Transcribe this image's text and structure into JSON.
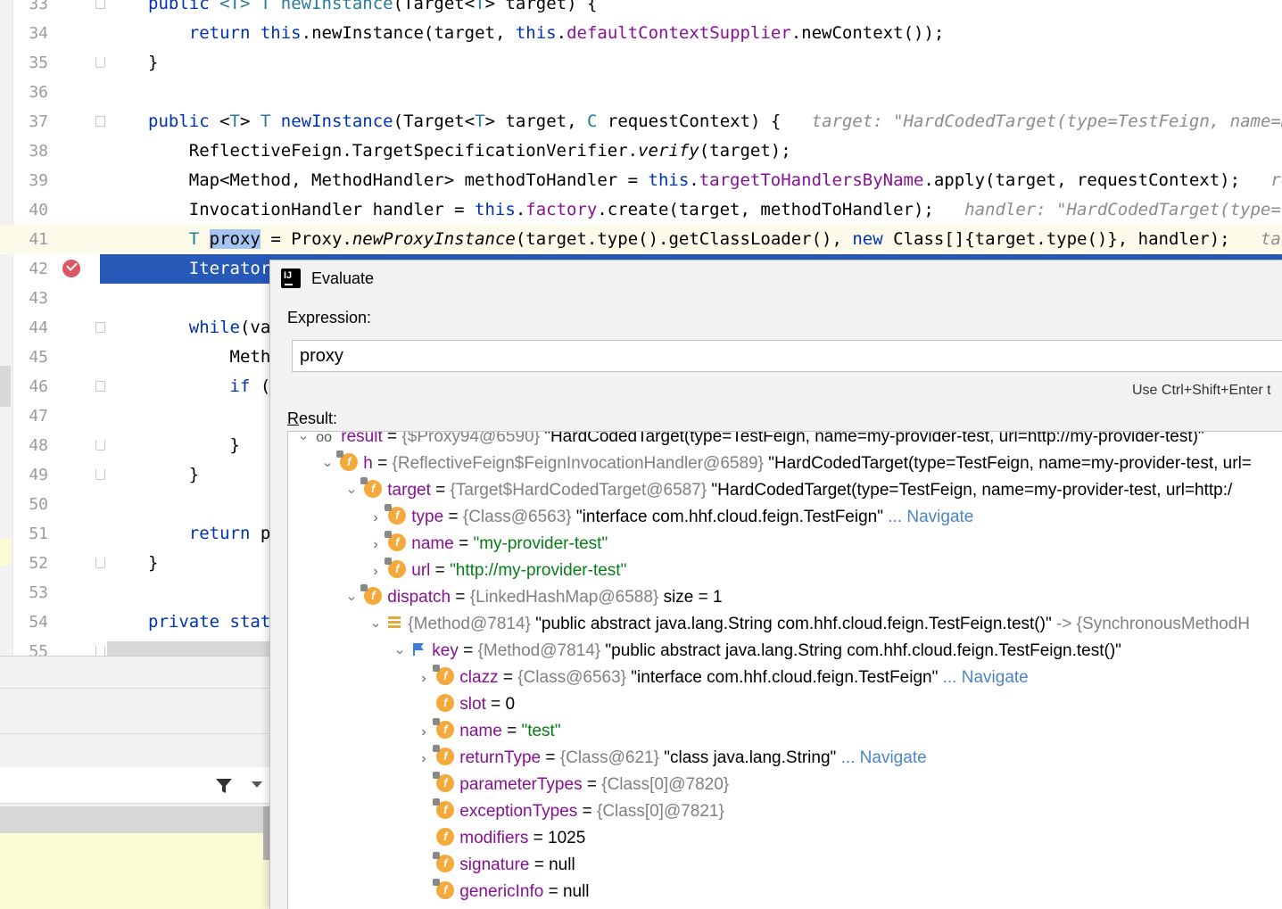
{
  "editor": {
    "lines": [
      {
        "num": "33",
        "html": "<span class=\"k\">public</span> <span class=\"t\">&lt;T&gt;</span> <span class=\"t\">T</span> <span class=\"t\">newInstance</span>(Target&lt;<span class=\"t\">T</span>&gt; target) {"
      },
      {
        "num": "34",
        "html": "    <span class=\"k\">return</span> <span class=\"k\">this</span>.newInstance(target, <span class=\"k\">this</span>.<span class=\"f\">defaultContextSupplier</span>.newContext());"
      },
      {
        "num": "35",
        "html": "}"
      },
      {
        "num": "36",
        "html": ""
      },
      {
        "num": "37",
        "html": "<span class=\"k\">public</span> &lt;<span class=\"t\">T</span>&gt; <span class=\"t\">T</span> <span class=\"k\">newInstance</span>(Target&lt;<span class=\"t\">T</span>&gt; target, <span class=\"t\">C</span> requestContext) {   <span class=\"hint\">target: \"HardCodedTarget(type=TestFeign, name=my</span>"
      },
      {
        "num": "38",
        "html": "    ReflectiveFeign.TargetSpecificationVerifier.<span class=\"i\">verify</span>(target);"
      },
      {
        "num": "39",
        "html": "    Map&lt;Method, MethodHandler&gt; methodToHandler = <span class=\"k\">this</span>.<span class=\"f\">targetToHandlersByName</span>.apply(target, requestContext);   <span class=\"hint\">reques</span>"
      },
      {
        "num": "40",
        "html": "    InvocationHandler handler = <span class=\"k\">this</span>.<span class=\"f\">factory</span>.create(target, methodToHandler);   <span class=\"hint\">handler: \"HardCodedTarget(type=Te</span>"
      },
      {
        "num": "41",
        "html": "    <span class=\"t\">T</span> <span class=\"sel\">proxy</span> = Proxy.<span class=\"i\">newProxyInstance</span>(target.type().getClassLoader(), <span class=\"k\">new</span> Class[]{target.type()}, handler);   <span class=\"hint\">targe</span>"
      },
      {
        "num": "42",
        "html": "    Iterator"
      },
      {
        "num": "43",
        "html": ""
      },
      {
        "num": "44",
        "html": "    <span class=\"k\">while</span>(var"
      },
      {
        "num": "45",
        "html": "        Metho"
      },
      {
        "num": "46",
        "html": "        <span class=\"k\">if</span> (r"
      },
      {
        "num": "47",
        "html": "            ("
      },
      {
        "num": "48",
        "html": "        }"
      },
      {
        "num": "49",
        "html": "    }"
      },
      {
        "num": "50",
        "html": ""
      },
      {
        "num": "51",
        "html": "    <span class=\"k\">return</span> pr"
      },
      {
        "num": "52",
        "html": "}"
      },
      {
        "num": "53",
        "html": ""
      },
      {
        "num": "54",
        "html": "<span class=\"k\">private</span> <span class=\"k\">stati</span>"
      },
      {
        "num": "55",
        "html": "    <span class=\"k\">private</span> T"
      }
    ]
  },
  "dialog": {
    "title": "Evaluate",
    "expression_label": "Expression:",
    "expression_value": "proxy",
    "hint": "Use Ctrl+Shift+Enter t",
    "result_label_u": "R",
    "result_label_rest": "esult:",
    "tree": [
      {
        "depth": 0,
        "arrow": "open",
        "icon": "glasses",
        "name": "result",
        "type": "{$Proxy94@6590}",
        "value": "\"HardCodedTarget(type=TestFeign, name=my-provider-test, url=http://my-provider-test)\"",
        "vclass": "",
        "nav": ""
      },
      {
        "depth": 1,
        "arrow": "open",
        "icon": "field",
        "name": "h",
        "type": "{ReflectiveFeign$FeignInvocationHandler@6589}",
        "value": "\"HardCodedTarget(type=TestFeign, name=my-provider-test, url=",
        "vclass": "",
        "nav": ""
      },
      {
        "depth": 2,
        "arrow": "open",
        "icon": "field",
        "name": "target",
        "type": "{Target$HardCodedTarget@6587}",
        "value": "\"HardCodedTarget(type=TestFeign, name=my-provider-test, url=http:/",
        "vclass": "",
        "nav": ""
      },
      {
        "depth": 3,
        "arrow": "closed",
        "icon": "field",
        "name": "type",
        "type": "{Class@6563}",
        "value": "\"interface com.hhf.cloud.feign.TestFeign\"",
        "vclass": "",
        "nav": "... Navigate"
      },
      {
        "depth": 3,
        "arrow": "closed",
        "icon": "field",
        "name": "name",
        "type": "",
        "value": "\"my-provider-test\"",
        "vclass": "sv",
        "nav": ""
      },
      {
        "depth": 3,
        "arrow": "closed",
        "icon": "field",
        "name": "url",
        "type": "",
        "value": "\"http://my-provider-test\"",
        "vclass": "sv",
        "nav": ""
      },
      {
        "depth": 2,
        "arrow": "open",
        "icon": "field",
        "name": "dispatch",
        "type": "{LinkedHashMap@6588}",
        "value": " size = 1",
        "vclass": "",
        "nav": ""
      },
      {
        "depth": 3,
        "arrow": "open",
        "icon": "entry",
        "name": "",
        "type": "{Method@7814}",
        "value": "\"public abstract java.lang.String com.hhf.cloud.feign.TestFeign.test()\"",
        "vclass": "",
        "nav": "-> {SynchronousMethodH"
      },
      {
        "depth": 4,
        "arrow": "open",
        "icon": "flag",
        "name": "key",
        "type": "{Method@7814}",
        "value": "\"public abstract java.lang.String com.hhf.cloud.feign.TestFeign.test()\"",
        "vclass": "",
        "nav": ""
      },
      {
        "depth": 5,
        "arrow": "closed",
        "icon": "field",
        "name": "clazz",
        "type": "{Class@6563}",
        "value": "\"interface com.hhf.cloud.feign.TestFeign\"",
        "vclass": "",
        "nav": "... Navigate"
      },
      {
        "depth": 5,
        "arrow": "none",
        "icon": "field",
        "name": "slot",
        "type": "",
        "value": "0",
        "vclass": "",
        "nav": ""
      },
      {
        "depth": 5,
        "arrow": "closed",
        "icon": "field",
        "name": "name",
        "type": "",
        "value": "\"test\"",
        "vclass": "sv",
        "nav": ""
      },
      {
        "depth": 5,
        "arrow": "closed",
        "icon": "field",
        "name": "returnType",
        "type": "{Class@621}",
        "value": "\"class java.lang.String\"",
        "vclass": "",
        "nav": "... Navigate"
      },
      {
        "depth": 5,
        "arrow": "none",
        "icon": "field",
        "name": "parameterTypes",
        "type": "{Class[0]@7820}",
        "value": "",
        "vclass": "",
        "nav": ""
      },
      {
        "depth": 5,
        "arrow": "none",
        "icon": "field",
        "name": "exceptionTypes",
        "type": "{Class[0]@7821}",
        "value": "",
        "vclass": "",
        "nav": ""
      },
      {
        "depth": 5,
        "arrow": "none",
        "icon": "field",
        "name": "modifiers",
        "type": "",
        "value": "1025",
        "vclass": "",
        "nav": ""
      },
      {
        "depth": 5,
        "arrow": "none",
        "icon": "field",
        "name": "signature",
        "type": "",
        "value": "null",
        "vclass": "",
        "nav": ""
      },
      {
        "depth": 5,
        "arrow": "none",
        "icon": "field",
        "name": "genericInfo",
        "type": "",
        "value": "null",
        "vclass": "",
        "nav": ""
      }
    ]
  }
}
